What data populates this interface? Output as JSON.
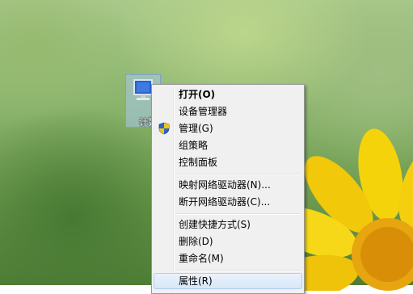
{
  "desktop": {
    "icon_label": "计算机"
  },
  "context_menu": {
    "items": [
      {
        "label": "打开(O)"
      },
      {
        "label": "设备管理器"
      },
      {
        "label": "管理(G)"
      },
      {
        "label": "组策略"
      },
      {
        "label": "控制面板"
      },
      {
        "label": "映射网络驱动器(N)..."
      },
      {
        "label": "断开网络驱动器(C)..."
      },
      {
        "label": "创建快捷方式(S)"
      },
      {
        "label": "删除(D)"
      },
      {
        "label": "重命名(M)"
      },
      {
        "label": "属性(R)"
      }
    ]
  },
  "colors": {
    "menu_bg": "#f0f0f0",
    "highlight": "#d9e7f8",
    "flower": "#f5d30a"
  },
  "icons": {
    "shield": "uac-shield-icon",
    "computer": "computer-icon"
  }
}
